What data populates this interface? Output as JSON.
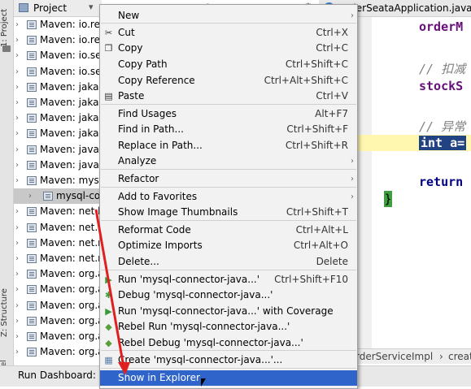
{
  "sidebar": {
    "project_tab": "1: Project",
    "structure_tab": "Z: Structure",
    "rebel_tab": "JRebel"
  },
  "project_panel": {
    "title": "Project"
  },
  "tree": {
    "rows": [
      {
        "label": "Maven: io.rea"
      },
      {
        "label": "Maven: io.rea"
      },
      {
        "label": "Maven: io.sea"
      },
      {
        "label": "Maven: io.sea"
      },
      {
        "label": "Maven: jakarta"
      },
      {
        "label": "Maven: jakarta"
      },
      {
        "label": "Maven: jakarta"
      },
      {
        "label": "Maven: jakarta"
      },
      {
        "label": "Maven: javax.i"
      },
      {
        "label": "Maven: javax.v"
      },
      {
        "label": "Maven: mysql"
      },
      {
        "label": "mysql-conn"
      },
      {
        "label": "Maven: net.by"
      },
      {
        "label": "Maven: net.by"
      },
      {
        "label": "Maven: net.mi"
      },
      {
        "label": "Maven: net.mi"
      },
      {
        "label": "Maven: org.ap"
      },
      {
        "label": "Maven: org.ap"
      },
      {
        "label": "Maven: org.ap"
      },
      {
        "label": "Maven: org.ap"
      },
      {
        "label": "Maven: org.ap"
      },
      {
        "label": "Maven: org.ap"
      }
    ]
  },
  "editor_tab": {
    "label": "OrderSeataApplication.java"
  },
  "code": {
    "line1": "orderM",
    "comment1": "// 扣减",
    "line2": "stockS",
    "comment2": "// 异常",
    "line3": "int a=",
    "line4": "return",
    "brace": "}"
  },
  "breadcrumb": {
    "item1": "rderServiceImpl",
    "sep": "›",
    "item2": "creater"
  },
  "status": {
    "run_dashboard": "Run Dashboard:"
  },
  "menu": {
    "items": [
      {
        "label": "New",
        "shortcut": "",
        "submenu": true,
        "icon": ""
      },
      {
        "label": "Cut",
        "shortcut": "Ctrl+X",
        "submenu": false,
        "icon": "scissors-icon"
      },
      {
        "label": "Copy",
        "shortcut": "Ctrl+C",
        "submenu": false,
        "icon": "copy-icon"
      },
      {
        "label": "Copy Path",
        "shortcut": "Ctrl+Shift+C",
        "submenu": false,
        "icon": ""
      },
      {
        "label": "Copy Reference",
        "shortcut": "Ctrl+Alt+Shift+C",
        "submenu": false,
        "icon": ""
      },
      {
        "label": "Paste",
        "shortcut": "Ctrl+V",
        "submenu": false,
        "icon": "paste-icon"
      },
      {
        "label": "Find Usages",
        "shortcut": "Alt+F7",
        "submenu": false,
        "icon": ""
      },
      {
        "label": "Find in Path...",
        "shortcut": "Ctrl+Shift+F",
        "submenu": false,
        "icon": ""
      },
      {
        "label": "Replace in Path...",
        "shortcut": "Ctrl+Shift+R",
        "submenu": false,
        "icon": ""
      },
      {
        "label": "Analyze",
        "shortcut": "",
        "submenu": true,
        "icon": ""
      },
      {
        "label": "Refactor",
        "shortcut": "",
        "submenu": true,
        "icon": ""
      },
      {
        "label": "Add to Favorites",
        "shortcut": "",
        "submenu": true,
        "icon": ""
      },
      {
        "label": "Show Image Thumbnails",
        "shortcut": "Ctrl+Shift+T",
        "submenu": false,
        "icon": ""
      },
      {
        "label": "Reformat Code",
        "shortcut": "Ctrl+Alt+L",
        "submenu": false,
        "icon": ""
      },
      {
        "label": "Optimize Imports",
        "shortcut": "Ctrl+Alt+O",
        "submenu": false,
        "icon": ""
      },
      {
        "label": "Delete...",
        "shortcut": "Delete",
        "submenu": false,
        "icon": ""
      },
      {
        "label": "Run 'mysql-connector-java...'",
        "shortcut": "Ctrl+Shift+F10",
        "submenu": false,
        "icon": "run-icon"
      },
      {
        "label": "Debug 'mysql-connector-java...'",
        "shortcut": "",
        "submenu": false,
        "icon": "debug-icon"
      },
      {
        "label": "Run 'mysql-connector-java...' with Coverage",
        "shortcut": "",
        "submenu": false,
        "icon": "coverage-icon"
      },
      {
        "label": "Rebel Run 'mysql-connector-java...'",
        "shortcut": "",
        "submenu": false,
        "icon": "rebel-run-icon"
      },
      {
        "label": "Rebel Debug 'mysql-connector-java...'",
        "shortcut": "",
        "submenu": false,
        "icon": "rebel-debug-icon"
      },
      {
        "label": "Create 'mysql-connector-java...'...",
        "shortcut": "",
        "submenu": false,
        "icon": "create-icon"
      },
      {
        "label": "Show in Explorer",
        "shortcut": "",
        "submenu": false,
        "icon": ""
      }
    ]
  },
  "colors": {
    "highlight": "#2f65ca",
    "annotation_arrow": "#e02020",
    "editor_bg": "#ffffff",
    "selection": "#214283"
  }
}
